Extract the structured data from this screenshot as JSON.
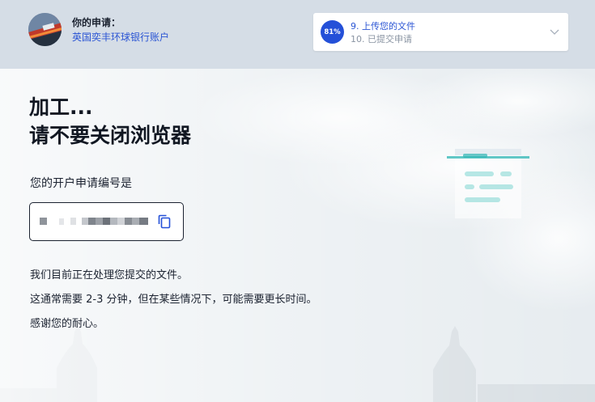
{
  "header": {
    "application_caption": "你的申请：",
    "application_value": "英国奕丰环球银行账户",
    "progress": {
      "percent_label": "81%",
      "percent": 81,
      "current_step": "9. 上传您的文件",
      "next_step": "10. 已提交申请"
    }
  },
  "main": {
    "heading_line1": "加工...",
    "heading_line2": "请不要关闭浏览器",
    "reference_label": "您的开户申请编号是",
    "reference_number": "",
    "info_lines": [
      "我们目前正在处理您提交的文件。",
      "这通常需要 2-3 分钟，但在某些情况下，可能需要更长时间。",
      "感谢您的耐心。"
    ]
  },
  "colors": {
    "header_bg": "#d5dde6",
    "accent_blue": "#2450d8",
    "link_blue": "#2b55d4",
    "text_dark": "#1b2230",
    "illustration_teal": "#2eb5b4"
  },
  "icons": {
    "avatar": "avatar-image",
    "chevron": "chevron-down-icon",
    "copy": "copy-icon",
    "illustration": "document-illustration"
  }
}
